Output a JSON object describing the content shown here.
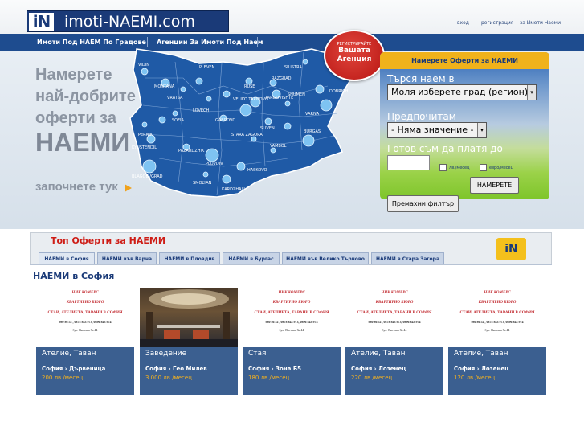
{
  "header": {
    "logo_mark": "iN",
    "logo_text": "imoti-NAEMI.com",
    "links": [
      "вход",
      "регистрация",
      "за Имоти Наеми"
    ]
  },
  "nav": {
    "items": [
      "Имоти Под НАЕМ По Градове",
      "Агенции За Имоти Под Наем"
    ]
  },
  "hero": {
    "lines": [
      "Намерете",
      "най-добрите",
      "оферти за"
    ],
    "big": "НАЕМИ",
    "start": "започнете тук"
  },
  "map": {
    "cities": [
      "VIDIN",
      "SILISTRA",
      "MONTANA",
      "PLEVEN",
      "RUSE",
      "RAZGRAD",
      "VRATSA",
      "LOVECH",
      "VELIKO TARNOVO",
      "TARGOVISHTE",
      "SHUMEN",
      "DOBRICH",
      "VARNA",
      "SOFIA",
      "GABROVO",
      "PERNIK",
      "KYUSTENDIL",
      "STARA ZAGORA",
      "SLIVEN",
      "BURGAS",
      "PAZARDZHIK",
      "YAMBOL",
      "BLAGOEVGRAD",
      "PLOVDIV",
      "HASKOVO",
      "SMOLYAN",
      "KARDZHALI"
    ]
  },
  "badge": {
    "line1": "РЕГИСТРИРАЙТЕ",
    "line2": "Вашата",
    "line3": "Агенция"
  },
  "search": {
    "title": "Намерете Оферти за НАЕМИ",
    "label_rent": "Търся наем в",
    "select_city": "Моля изберете град (регион)",
    "label_pref": "Предпочитам",
    "select_pref": "- Няма значение -",
    "label_price": "Готов съм да платя до",
    "price_value": "",
    "unit_lv": "лв./месец",
    "unit_eur": "евро/месец",
    "find_button": "НАМЕРЕТЕ",
    "reset_button": "Премахни филтър"
  },
  "offers": {
    "title": "Топ Оферти за НАЕМИ",
    "in_badge": "iN",
    "tabs": [
      "НАЕМИ в София",
      "НАЕМИ във Варна",
      "НАЕМИ в Пловдив",
      "НАЕМИ в Бургас",
      "НАЕМИ във Велико Търново",
      "НАЕМИ в Стара Загора"
    ],
    "panel_title": "НАЕМИ в София",
    "ad": {
      "line1": "НИК КОМЕРС",
      "line2": "КВАРТИРНО БЮРО",
      "line3": "СТАИ, АТЕЛИЕТА, ТАВАНИ В СОФИЯ",
      "line4": "980 86 52 , 0878 843 973, 0896 843 974",
      "line5": "бул. Витоша № 44"
    },
    "cards": [
      {
        "type": "Ателие, Таван",
        "location": "София › Дървеница",
        "price": "200 лв./месец",
        "image": "ad"
      },
      {
        "type": "Заведение",
        "location": "София › Гео Милев",
        "price": "3 000 лв./месец",
        "image": "photo"
      },
      {
        "type": "Стая",
        "location": "София › Зона Б5",
        "price": "180 лв./месец",
        "image": "ad"
      },
      {
        "type": "Ателие, Таван",
        "location": "София › Лозенец",
        "price": "220 лв./месец",
        "image": "ad"
      },
      {
        "type": "Ателие, Таван",
        "location": "София › Лозенец",
        "price": "120 лв./месец",
        "image": "ad"
      }
    ]
  },
  "colors": {
    "brand": "#1a3a78",
    "nav": "#1e4c8f",
    "accent": "#f0b21b",
    "red": "#ce1d16",
    "card": "#3b5f90"
  }
}
